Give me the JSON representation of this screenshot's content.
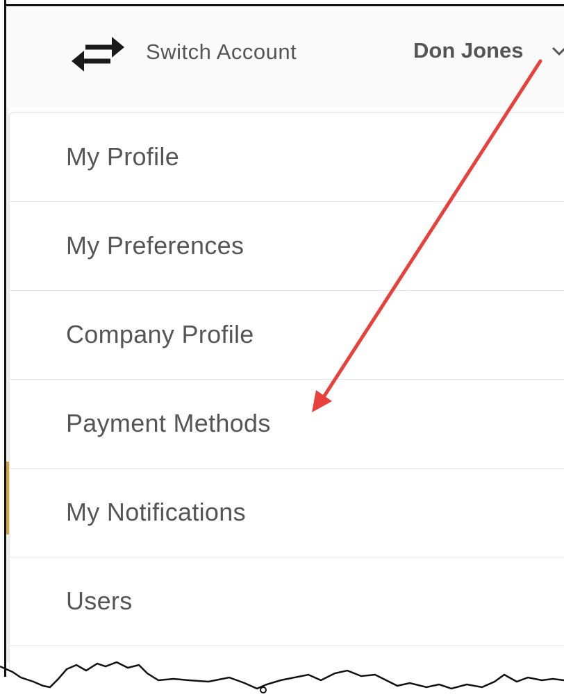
{
  "header": {
    "switch_account_label": "Switch Account",
    "user_name": "Don Jones"
  },
  "menu": {
    "items": [
      {
        "label": "My Profile"
      },
      {
        "label": "My Preferences"
      },
      {
        "label": "Company Profile"
      },
      {
        "label": "Payment Methods"
      },
      {
        "label": "My Notifications"
      },
      {
        "label": "Users"
      }
    ]
  },
  "icons": {
    "switch": "switch-arrows-icon",
    "dropdown": "chevron-down-icon"
  },
  "colors": {
    "text": "#555555",
    "annotation_arrow": "#e8403a",
    "accent_strip": "#d9a640"
  }
}
